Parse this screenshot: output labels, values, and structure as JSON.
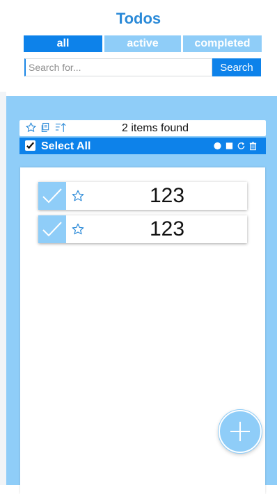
{
  "app": {
    "title": "Todos"
  },
  "filters": {
    "tabs": [
      {
        "label": "all",
        "active": true
      },
      {
        "label": "active",
        "active": false
      },
      {
        "label": "completed",
        "active": false
      }
    ]
  },
  "search": {
    "placeholder": "Search for...",
    "value": "",
    "button_label": "Search"
  },
  "toolbar": {
    "icons": [
      "star-outline-icon",
      "copy-icon",
      "sort-icon"
    ],
    "result_text": "2 items found"
  },
  "bulk_actions": {
    "select_all_label": "Select All",
    "select_all_checked": true,
    "icons": [
      "circle-icon",
      "square-icon",
      "refresh-icon",
      "trash-icon"
    ]
  },
  "todos": [
    {
      "text": "123",
      "completed": true,
      "starred": false
    },
    {
      "text": "123",
      "completed": true,
      "starred": false
    }
  ],
  "fab": {
    "icon": "plus-icon"
  },
  "colors": {
    "accent": "#0d82ea",
    "light_accent": "#8fcdf8",
    "title": "#2b8ad8"
  }
}
